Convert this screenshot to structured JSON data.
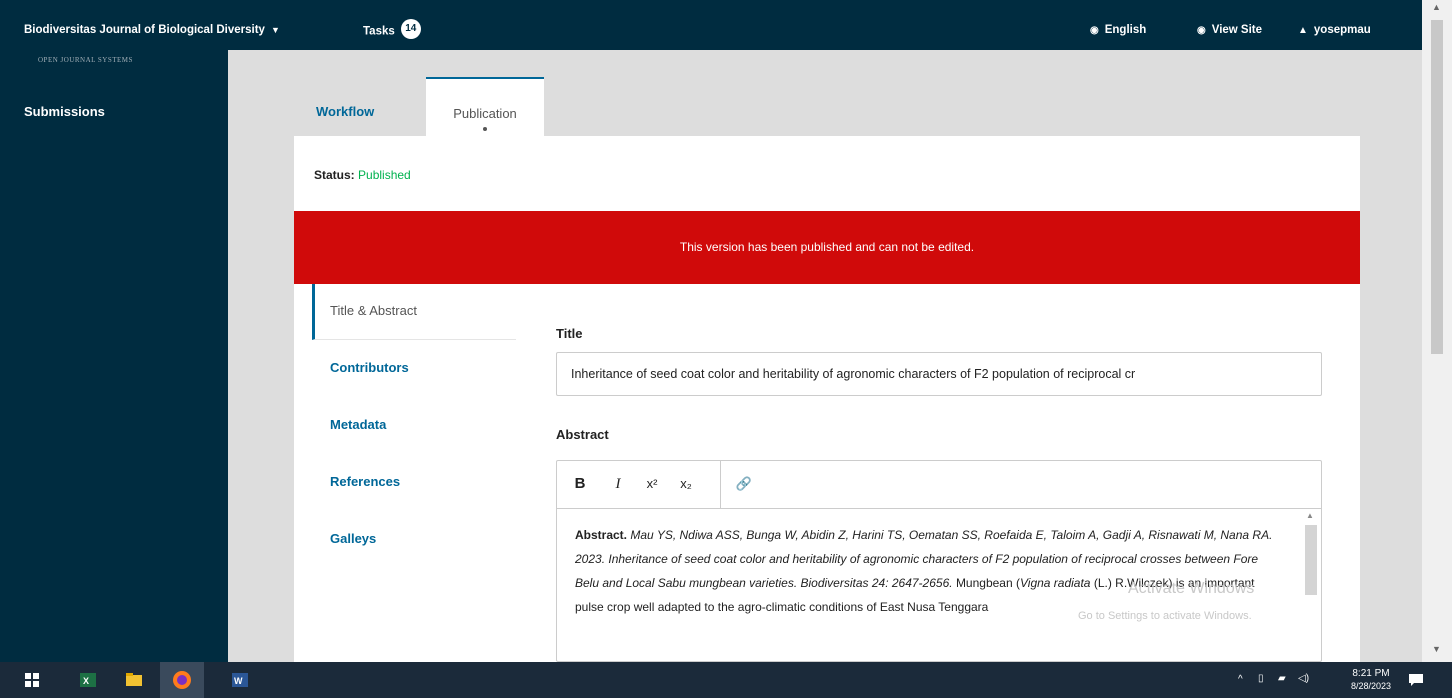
{
  "topbar": {
    "site_name": "Biodiversitas Journal of Biological Diversity",
    "site_caret": "▼",
    "tasks_label": "Tasks",
    "tasks_count": "14",
    "language": "English",
    "view_site": "View Site",
    "username": "yosepmau"
  },
  "sidebar": {
    "logo_text": "OPEN JOURNAL SYSTEMS",
    "items": [
      {
        "label": "Submissions"
      }
    ]
  },
  "tabs": [
    {
      "label": "Workflow"
    },
    {
      "label": "Publication"
    }
  ],
  "status": {
    "label": "Status:",
    "value": "Published"
  },
  "notice": "This version has been published and can not be edited.",
  "subnav": [
    {
      "label": "Title & Abstract"
    },
    {
      "label": "Contributors"
    },
    {
      "label": "Metadata"
    },
    {
      "label": "References"
    },
    {
      "label": "Galleys"
    }
  ],
  "form": {
    "title_label": "Title",
    "title_value": "Inheritance of seed coat color and heritability of agronomic characters of F2 population of reciprocal cr",
    "abstract_label": "Abstract",
    "toolbar": {
      "bold": "B",
      "italic": "I",
      "superscript": "x²",
      "subscript": "x₂",
      "link": "🔗"
    },
    "abstract": {
      "lead": "Abstract.",
      "citation": "Mau YS, Ndiwa ASS, Bunga W, Abidin Z, Harini TS, Oematan SS, Roefaida E, Taloim A, Gadji A, Risnawati M, Nana RA. 2023. Inheritance of seed coat color and heritability of agronomic characters of F2 population of reciprocal crosses between Fore Belu and Local Sabu mungbean varieties. Biodiversitas 24: 2647-2656.",
      "body1": "Mungbean (",
      "species": "Vigna radiata",
      "body2": " (L.) R.Wilczek) is an important pulse crop well adapted to the agro-climatic conditions of East Nusa Tenggara"
    }
  },
  "watermark": {
    "line1": "Activate Windows",
    "line2": "Go to Settings to activate Windows."
  },
  "taskbar": {
    "time": "8:21 PM",
    "date": "8/28/2023"
  },
  "colors": {
    "navy": "#002c40",
    "link": "#006798",
    "published": "#00b24e",
    "notice": "#d00a0a"
  }
}
